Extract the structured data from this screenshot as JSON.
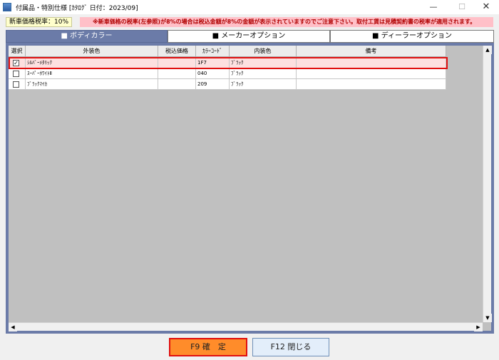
{
  "window": {
    "title": "付属品・特別仕様 [ｶﾀﾛｸﾞ 日付：2023/09]",
    "minimize": "—",
    "maximize": "☐",
    "close": "✕"
  },
  "tax_badge": "新車価格税率：10%",
  "notice": "※新車価格の税率(左参照)が8%の場合は税込金額が8%の金額が表示されていますのでご注意下さい。取付工賃は見積契約書の税率が適用されます。",
  "tabs": [
    {
      "label": "■ ボディカラー",
      "active": true
    },
    {
      "label": "■ メーカーオプション",
      "active": false
    },
    {
      "label": "■ ディーラーオプション",
      "active": false
    }
  ],
  "table": {
    "headers": [
      "選択",
      "外装色",
      "税込価格",
      "ｶﾗｰｺｰﾄﾞ",
      "内装色",
      "備考"
    ],
    "rows": [
      {
        "checked": true,
        "exterior": "ｼﾙﾊﾞｰﾒﾀﾘｯｸ",
        "price": "",
        "code": "1F7",
        "interior": "ﾌﾞﾗｯｸ",
        "note": ""
      },
      {
        "checked": false,
        "exterior": "ｽｰﾊﾟｰﾎﾜｲﾄⅡ",
        "price": "",
        "code": "040",
        "interior": "ﾌﾞﾗｯｸ",
        "note": ""
      },
      {
        "checked": false,
        "exterior": "ﾌﾞﾗｯｸﾏｲｶ",
        "price": "",
        "code": "209",
        "interior": "ﾌﾞﾗｯｸ",
        "note": ""
      }
    ]
  },
  "scroll": {
    "up": "▲",
    "down": "▼",
    "left": "◀",
    "right": "▶"
  },
  "buttons": {
    "confirm": "F9 確　定",
    "close": "F12 閉じる"
  },
  "colors": {
    "tab_active": "#6b7ba8",
    "notice_bg": "#ffc0c8",
    "selected_outline": "#e01010",
    "confirm_bg": "#ff8c2a"
  }
}
